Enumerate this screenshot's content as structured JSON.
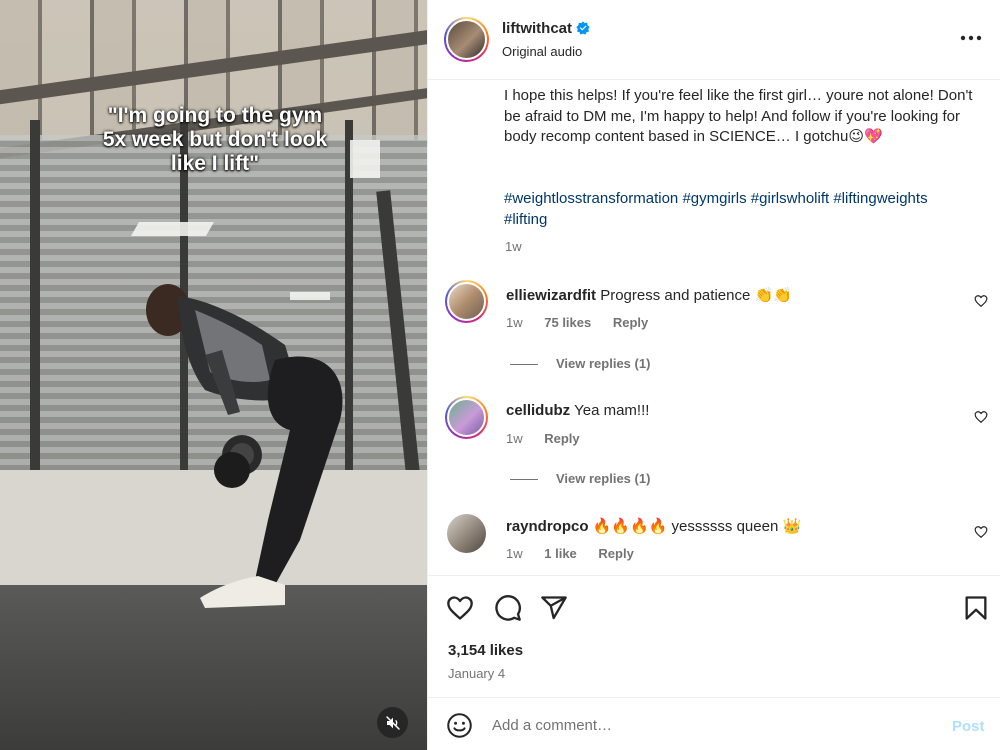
{
  "media": {
    "overlay_text": "\"I'm going to the gym 5x week but don't look like I lift\"",
    "mute_icon": "speaker-muted-icon"
  },
  "header": {
    "username": "liftwithcat",
    "verified_icon": "verified-badge-icon",
    "subtitle": "Original audio",
    "more_icon": "more-options-icon"
  },
  "caption": {
    "text": "I hope this helps! If you're feel like the first girl… youre not alone! Don't be afraid to DM me, I'm happy to help! And follow if you're looking for body recomp content based in SCIENCE… I gotchu😉💖",
    "hashtags": [
      "#weightlosstransformation",
      "#gymgirls",
      "#girlswholift",
      "#liftingweights",
      "#lifting"
    ],
    "time": "1w"
  },
  "comments": [
    {
      "username": "elliewizardfit",
      "text": "Progress and patience 👏👏",
      "time": "1w",
      "likes": "75 likes",
      "reply": "Reply",
      "view_replies": "View replies (1)"
    },
    {
      "username": "cellidubz",
      "text": "Yea mam!!!",
      "time": "1w",
      "reply": "Reply",
      "view_replies": "View replies (1)"
    },
    {
      "username": "rayndropco",
      "text": "🔥🔥🔥🔥 yessssss queen 👑",
      "time": "1w",
      "likes": "1 like",
      "reply": "Reply"
    }
  ],
  "actions": {
    "likes": "3,154 likes",
    "date": "January 4",
    "icons": [
      "heart-icon",
      "comment-icon",
      "share-icon",
      "bookmark-icon"
    ]
  },
  "add_comment": {
    "placeholder": "Add a comment…",
    "post_label": "Post",
    "emoji_icon": "emoji-icon"
  },
  "colors": {
    "link": "#00376b",
    "muted": "#737373",
    "text": "#262626",
    "post_disabled": "#b2dffc",
    "verified": "#0095f6"
  }
}
